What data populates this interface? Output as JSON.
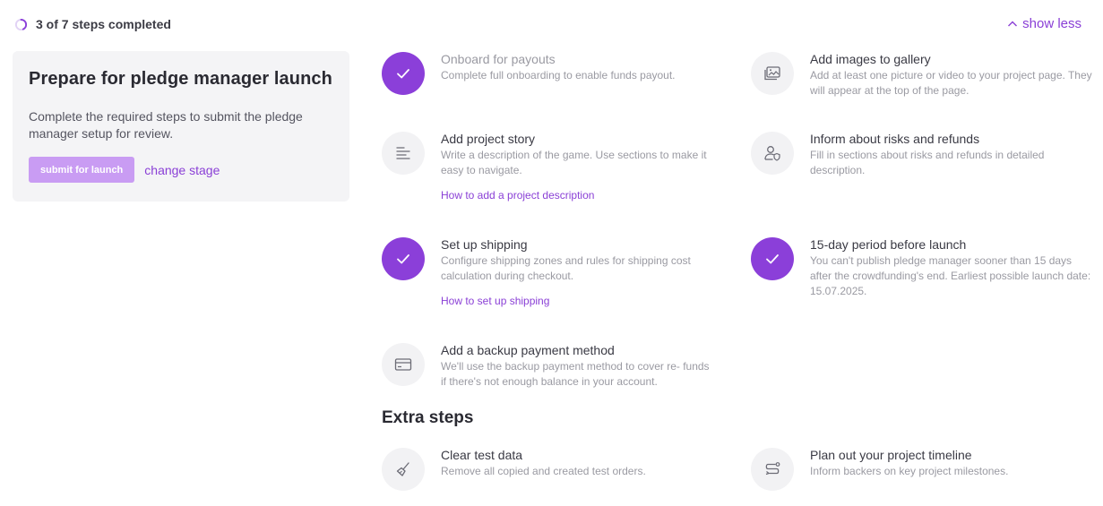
{
  "progress": {
    "text": "3 of 7 steps completed",
    "completed": 3,
    "total": 7,
    "accent": "#8b3fd9"
  },
  "toggle": {
    "label": "show less",
    "icon": "chevron-up-icon"
  },
  "card": {
    "title": "Prepare for pledge manager launch",
    "description": "Complete the required steps to submit the pledge manager setup for review.",
    "submit_label": "submit for launch",
    "change_label": "change stage"
  },
  "steps": [
    {
      "title": "Onboard for payouts",
      "description": "Complete full onboarding to enable funds payout.",
      "done": true,
      "icon": "check-icon"
    },
    {
      "title": "Add images to gallery",
      "description": "Add at least one picture or video to your project page. They will appear at the top of the page.",
      "done": false,
      "icon": "image-gallery-icon"
    },
    {
      "title": "Add project story",
      "description": "Write a description of the game. Use sections to make it easy to navigate.",
      "link": "How to add a project description",
      "done": false,
      "icon": "text-lines-icon"
    },
    {
      "title": "Inform about risks and refunds",
      "description": "Fill in sections about risks and refunds in detailed description.",
      "done": false,
      "icon": "user-shield-icon"
    },
    {
      "title": "Set up shipping",
      "description": "Configure shipping zones and rules for shipping cost calculation during checkout.",
      "link": "How to set up shipping",
      "done": true,
      "icon": "check-icon"
    },
    {
      "title": "15-day period before launch",
      "description": "You can't publish pledge manager sooner than 15 days after the crowdfunding's end. Earliest possible launch date: 15.07.2025.",
      "done": true,
      "icon": "check-icon"
    },
    {
      "title": "Add a backup payment method",
      "description": "We'll use the backup payment method to cover re- funds if there's not enough balance in your account.",
      "done": false,
      "icon": "credit-card-icon"
    }
  ],
  "extra": {
    "title": "Extra steps",
    "steps": [
      {
        "title": "Clear test data",
        "description": "Remove all copied and created test orders.",
        "icon": "broom-icon"
      },
      {
        "title": "Plan out your project timeline",
        "description": "Inform backers on key project milestones.",
        "icon": "route-timeline-icon"
      }
    ]
  }
}
